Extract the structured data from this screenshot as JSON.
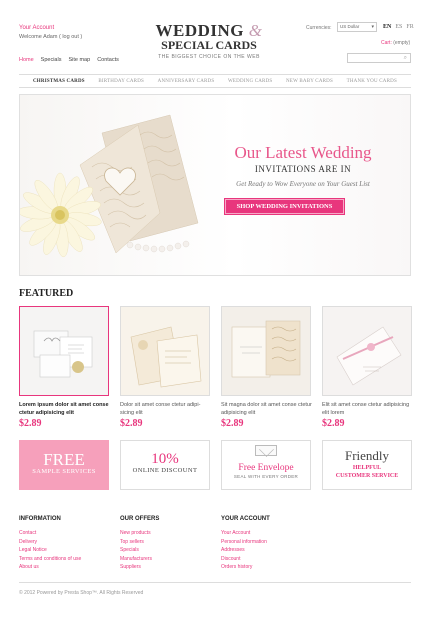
{
  "header": {
    "account": "Your Account",
    "welcome_prefix": "Welcome",
    "welcome_user": "Adam",
    "logout": "( log out )",
    "nav": [
      "Home",
      "Specials",
      "Site map",
      "Contacts"
    ],
    "logo_line1": "WEDDING",
    "logo_amp": "&",
    "logo_line2": "SPECIAL CARDS",
    "tagline": "THE BIGGEST CHOICE ON THE WEB",
    "currencies_label": "Currencies:",
    "currency": "US Dollar",
    "languages": [
      "EN",
      "ES",
      "FR"
    ],
    "cart_label": "Cart:",
    "cart_state": "(empty)",
    "search_placeholder": ""
  },
  "categories": [
    "CHRISTMAS CARDS",
    "BIRTHDAY CARDS",
    "ANNIVERSARY CARDS",
    "WEDDING CARDS",
    "NEW BABY CARDS",
    "THANK YOU CARDS"
  ],
  "banner": {
    "title": "Our Latest Wedding",
    "subtitle": "INVITATIONS ARE IN",
    "desc": "Get Ready to Wow Everyone on Your Guest List",
    "button": "SHOP WEDDING INVITATIONS"
  },
  "featured": {
    "title": "FEATURED",
    "products": [
      {
        "desc": "Lorem ipsum dolor sit amet conse ctetur adipisicing elit",
        "price": "$2.89"
      },
      {
        "desc": "Dolor sit amet conse ctetur adipi- sicing elit",
        "price": "$2.89"
      },
      {
        "desc": "Sit magna dolor sit amet conse ctetur adipisicing elit",
        "price": "$2.89"
      },
      {
        "desc": "Elit sit amet conse ctetur adipisicing elit lorem",
        "price": "$2.89"
      }
    ]
  },
  "promos": {
    "p1_big": "FREE",
    "p1_small": "SAMPLE SERVICES",
    "p2_big": "10%",
    "p2_small": "ONLINE DISCOUNT",
    "p3_big": "Free Envelope",
    "p3_small": "SEAL WITH EVERY ORDER",
    "p4_big": "Friendly",
    "p4_small": "HELPFUL CUSTOMER SERVICE"
  },
  "footer": {
    "info_title": "INFORMATION",
    "info_links": [
      "Contact",
      "Delivery",
      "Legal Notice",
      "Terms and conditions of use",
      "About us"
    ],
    "offers_title": "OUR OFFERS",
    "offers_links": [
      "New products",
      "Top sellers",
      "Specials",
      "Manufacturers",
      "Suppliers"
    ],
    "account_title": "YOUR ACCOUNT",
    "account_links": [
      "Your Account",
      "Personal information",
      "Addresses",
      "Discount",
      "Orders history"
    ],
    "copyright": "© 2012 Powered by Presta Shop™. All Rights Reserved"
  },
  "colors": {
    "accent": "#e8367d",
    "promo_pink": "#f6a0bb"
  }
}
